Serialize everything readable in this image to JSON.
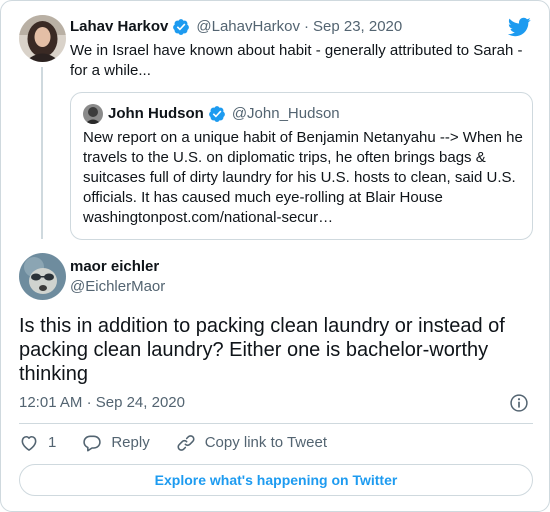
{
  "parent_tweet": {
    "author_name": "Lahav Harkov",
    "author_handle": "@LahavHarkov",
    "separator": "·",
    "date": "Sep 23, 2020",
    "text": "We in Israel have known about habit - generally attributed to Sarah - for a while...",
    "verified": true
  },
  "quoted_tweet": {
    "author_name": "John Hudson",
    "author_handle": "@John_Hudson",
    "text": "New report on a unique habit of Benjamin Netanyahu --> When he travels to the U.S. on diplomatic trips, he often brings bags & suitcases full of dirty laundry for his U.S. hosts to clean, said U.S. officials. It has caused much eye-rolling at Blair House washingtonpost.com/national-secur…",
    "verified": true
  },
  "main_tweet": {
    "author_name": "maor eichler",
    "author_handle": "@EichlerMaor",
    "text": "Is this in addition to packing clean laundry or instead of packing clean laundry? Either one is bachelor-worthy thinking",
    "time": "12:01 AM",
    "separator": "·",
    "date": "Sep 24, 2020"
  },
  "actions": {
    "like_count": "1",
    "reply_label": "Reply",
    "copy_link_label": "Copy link to Tweet"
  },
  "explore_label": "Explore what's happening on Twitter",
  "colors": {
    "twitter_blue": "#1d9bf0",
    "text_primary": "#0f1419",
    "text_secondary": "#536471",
    "border": "#cfd9de"
  },
  "icons": {
    "brand": "twitter-bird-icon",
    "verified": "verified-badge-icon",
    "info": "info-icon",
    "like": "heart-icon",
    "reply": "speech-bubble-icon",
    "copy_link": "link-icon"
  }
}
